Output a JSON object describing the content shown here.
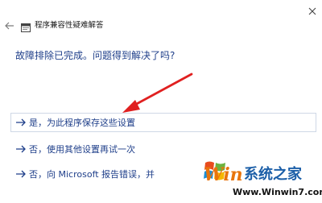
{
  "window": {
    "title": "程序兼容性疑难解答",
    "back_icon": "back-arrow-icon",
    "close_icon": "close-icon",
    "app_icon": "troubleshooter-app-icon"
  },
  "main": {
    "question": "故障排除已完成。问题得到解决了吗?",
    "options": [
      {
        "label": "是，为此程序保存这些设置",
        "icon": "arrow-right-icon"
      },
      {
        "label": "否，使用其他设置再试一次",
        "icon": "arrow-right-icon"
      },
      {
        "label": "否，向 Microsoft 报告错误，并",
        "icon": "arrow-right-icon"
      }
    ]
  },
  "annotation": {
    "icon": "red-pointer-arrow-icon",
    "color": "#e02020"
  },
  "watermark": {
    "logo_icon": "windows-flag-icon",
    "brand": "Win",
    "title": "系统之家",
    "url": "Www.Winwin7.com"
  },
  "colors": {
    "accent": "#1f3f8a",
    "watermark_blue": "#1c5fa8",
    "watermark_orange": "#e8740c"
  }
}
